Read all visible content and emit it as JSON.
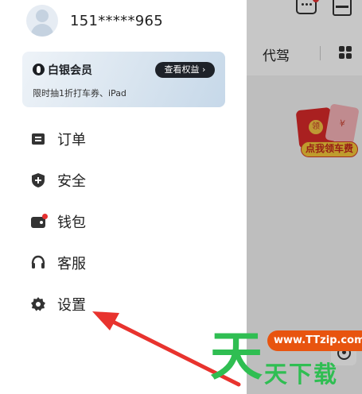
{
  "header": {
    "phone": "151*****965"
  },
  "member_card": {
    "title": "白银会员",
    "button_label": "查看权益",
    "subtitle": "限时抽1折打车券、iPad"
  },
  "menu": {
    "items": [
      {
        "label": "订单",
        "icon": "order-icon"
      },
      {
        "label": "安全",
        "icon": "shield-icon"
      },
      {
        "label": "钱包",
        "icon": "wallet-icon",
        "badge": true
      },
      {
        "label": "客服",
        "icon": "headset-icon"
      },
      {
        "label": "设置",
        "icon": "gear-icon"
      }
    ]
  },
  "background_app": {
    "tab_label": "代驾",
    "promo_label": "点我领车费"
  },
  "watermark": {
    "big_char": "天",
    "url": "www.TTzip.com",
    "text": "天下载"
  },
  "colors": {
    "accent_red": "#e53030",
    "arrow_red": "#e8332e",
    "watermark_green": "#2fbe52",
    "watermark_orange": "#e8540f"
  }
}
